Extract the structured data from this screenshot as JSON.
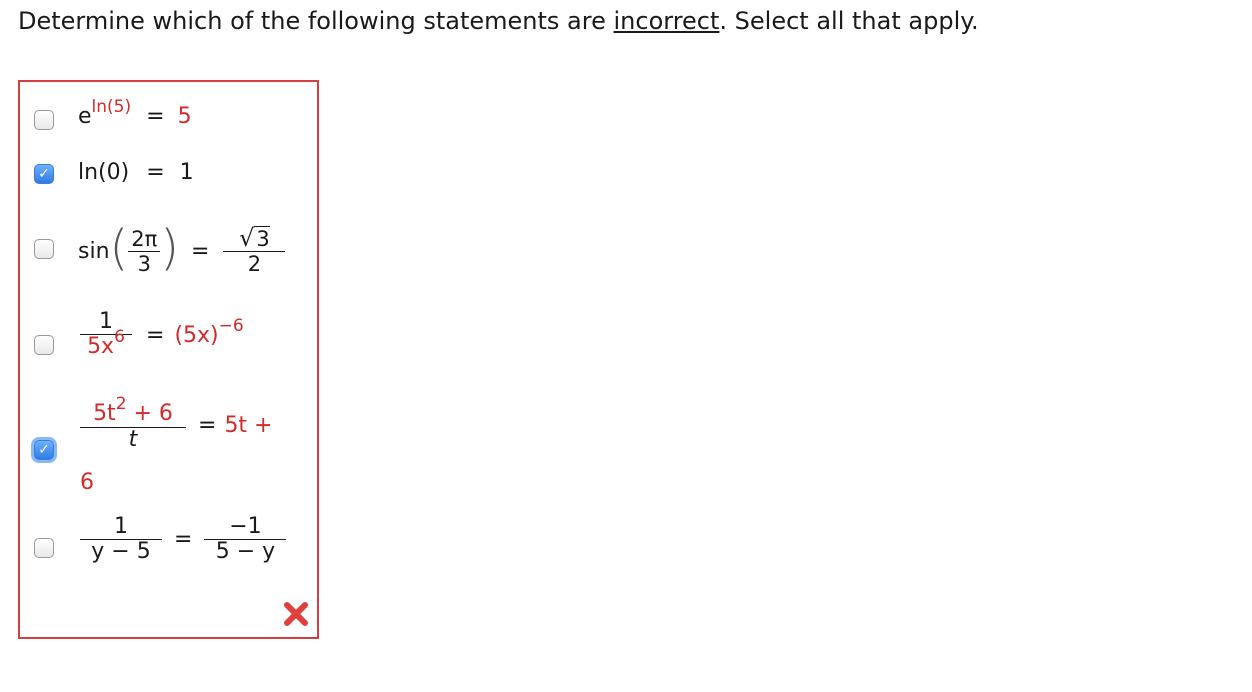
{
  "question": {
    "prefix": "Determine which of the following statements are ",
    "emphasis": "incorrect",
    "suffix": ". Select all that apply."
  },
  "options": [
    {
      "checked": false,
      "base": "e",
      "exp": "ln(5)",
      "eq": "=",
      "rhs": "5"
    },
    {
      "checked": true,
      "lhs": "ln(0)",
      "eq": "=",
      "rhs": "1"
    },
    {
      "checked": false,
      "fn": "sin",
      "num": "2π",
      "den": "3",
      "eq": "=",
      "rhs_num": "3",
      "rhs_den": "2"
    },
    {
      "checked": false,
      "num": "1",
      "den_base": "5x",
      "den_exp": "6",
      "eq": "=",
      "rhs_base": "(5x)",
      "rhs_exp": "−6"
    },
    {
      "checked": true,
      "num_a": "5t",
      "num_exp": "2",
      "num_b": " + 6",
      "den": "t",
      "eq": "=",
      "rhs": "5t +",
      "cont": "6"
    },
    {
      "checked": false,
      "num": "1",
      "den": "y − 5",
      "eq": "=",
      "rhs_num": "−1",
      "rhs_den": "5 − y"
    }
  ],
  "result_icon": "cross-icon",
  "colors": {
    "accent": "#d42a2a",
    "box_border": "#d43f3f",
    "checkbox_checked": "#2f7ae5"
  }
}
